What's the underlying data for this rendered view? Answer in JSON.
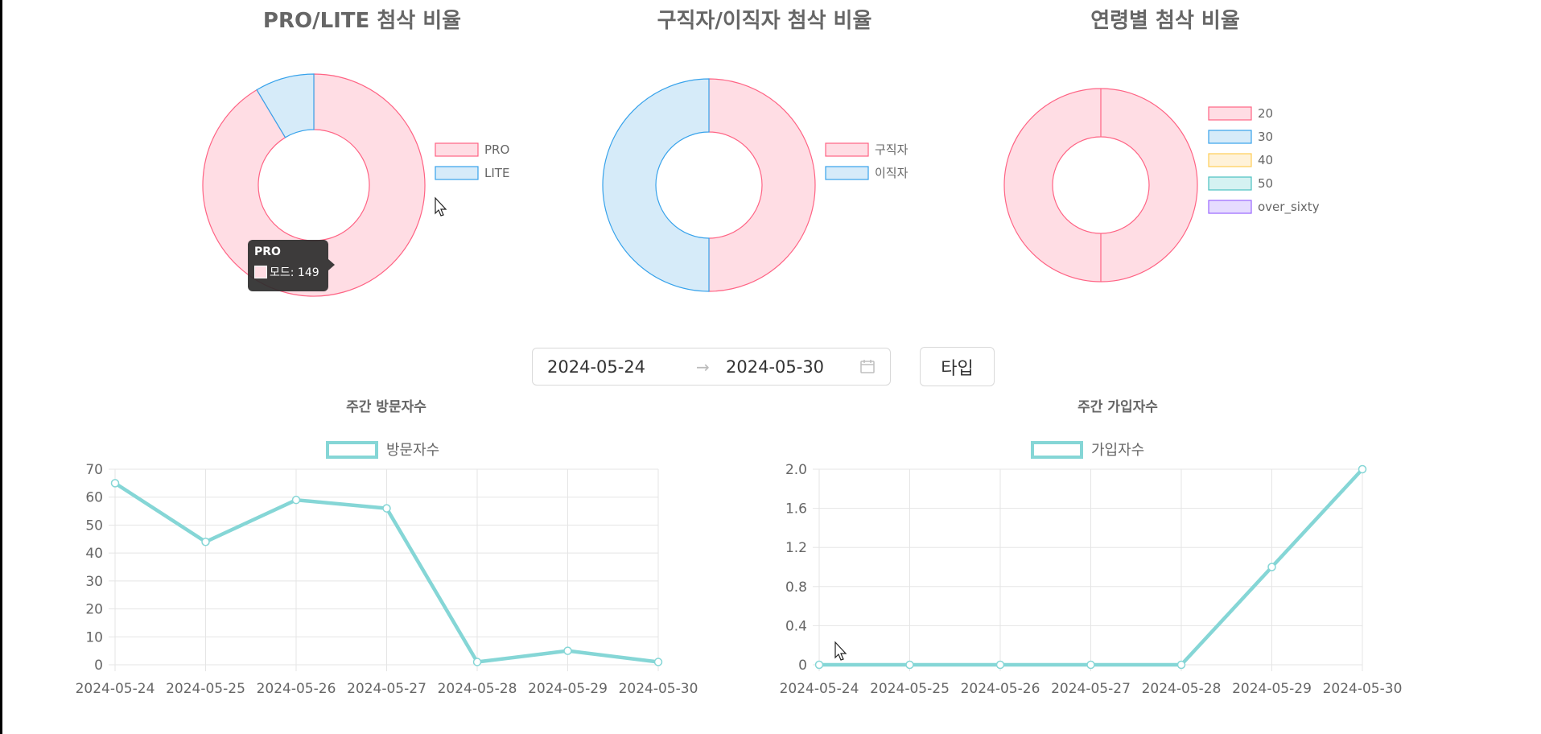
{
  "colors": {
    "pink_fill": "#ffdde4",
    "pink_stroke": "#ff6384",
    "blue_fill": "#d6ebf9",
    "blue_stroke": "#36a2eb",
    "yellow_fill": "#fff2d9",
    "yellow_stroke": "#ffcd56",
    "teal_fill": "#d5f2f2",
    "teal_stroke": "#4bc0c0",
    "purple_fill": "#e6dcff",
    "purple_stroke": "#9966ff",
    "line": "#85d6d6",
    "grid": "#e5e5e5",
    "title": "#666666"
  },
  "chart_data": [
    {
      "type": "pie",
      "title": "PRO/LITE 첨삭 비율",
      "labels": [
        "PRO",
        "LITE"
      ],
      "values": [
        149,
        14
      ],
      "series": [
        {
          "name": "모드",
          "values": [
            149,
            14
          ]
        }
      ]
    },
    {
      "type": "pie",
      "title": "구직자/이직자 첨삭 비율",
      "labels": [
        "구직자",
        "이직자"
      ],
      "values": [
        50,
        50
      ]
    },
    {
      "type": "pie",
      "title": "연령별 첨삭 비율",
      "labels": [
        "20",
        "30",
        "40",
        "50",
        "over_sixty"
      ],
      "values": [
        100,
        0,
        0,
        0,
        0
      ]
    },
    {
      "type": "line",
      "title": "주간 방문자수",
      "x": [
        "2024-05-24",
        "2024-05-25",
        "2024-05-26",
        "2024-05-27",
        "2024-05-28",
        "2024-05-29",
        "2024-05-30"
      ],
      "series": [
        {
          "name": "방문자수",
          "values": [
            65,
            44,
            59,
            56,
            1,
            5,
            1
          ]
        }
      ],
      "ylim": [
        0,
        70
      ],
      "yticks": [
        "70",
        "60",
        "50",
        "40",
        "30",
        "20",
        "10",
        "0"
      ],
      "grid": true
    },
    {
      "type": "line",
      "title": "주간 가입자수",
      "x": [
        "2024-05-24",
        "2024-05-25",
        "2024-05-26",
        "2024-05-27",
        "2024-05-28",
        "2024-05-29",
        "2024-05-30"
      ],
      "series": [
        {
          "name": "가입자수",
          "values": [
            0,
            0,
            0,
            0,
            0,
            1,
            2
          ]
        }
      ],
      "ylim": [
        0,
        2
      ],
      "yticks": [
        "2.0",
        "1.6",
        "1.2",
        "0.8",
        "0.4",
        "0"
      ],
      "grid": true
    }
  ],
  "tooltip": {
    "title": "PRO",
    "label": "모드: 149"
  },
  "date_range": {
    "start": "2024-05-24",
    "separator": "→",
    "end": "2024-05-30"
  },
  "type_button": {
    "label": "타입"
  },
  "icons": {
    "calendar": "calendar-icon",
    "cursor": "cursor-icon"
  }
}
